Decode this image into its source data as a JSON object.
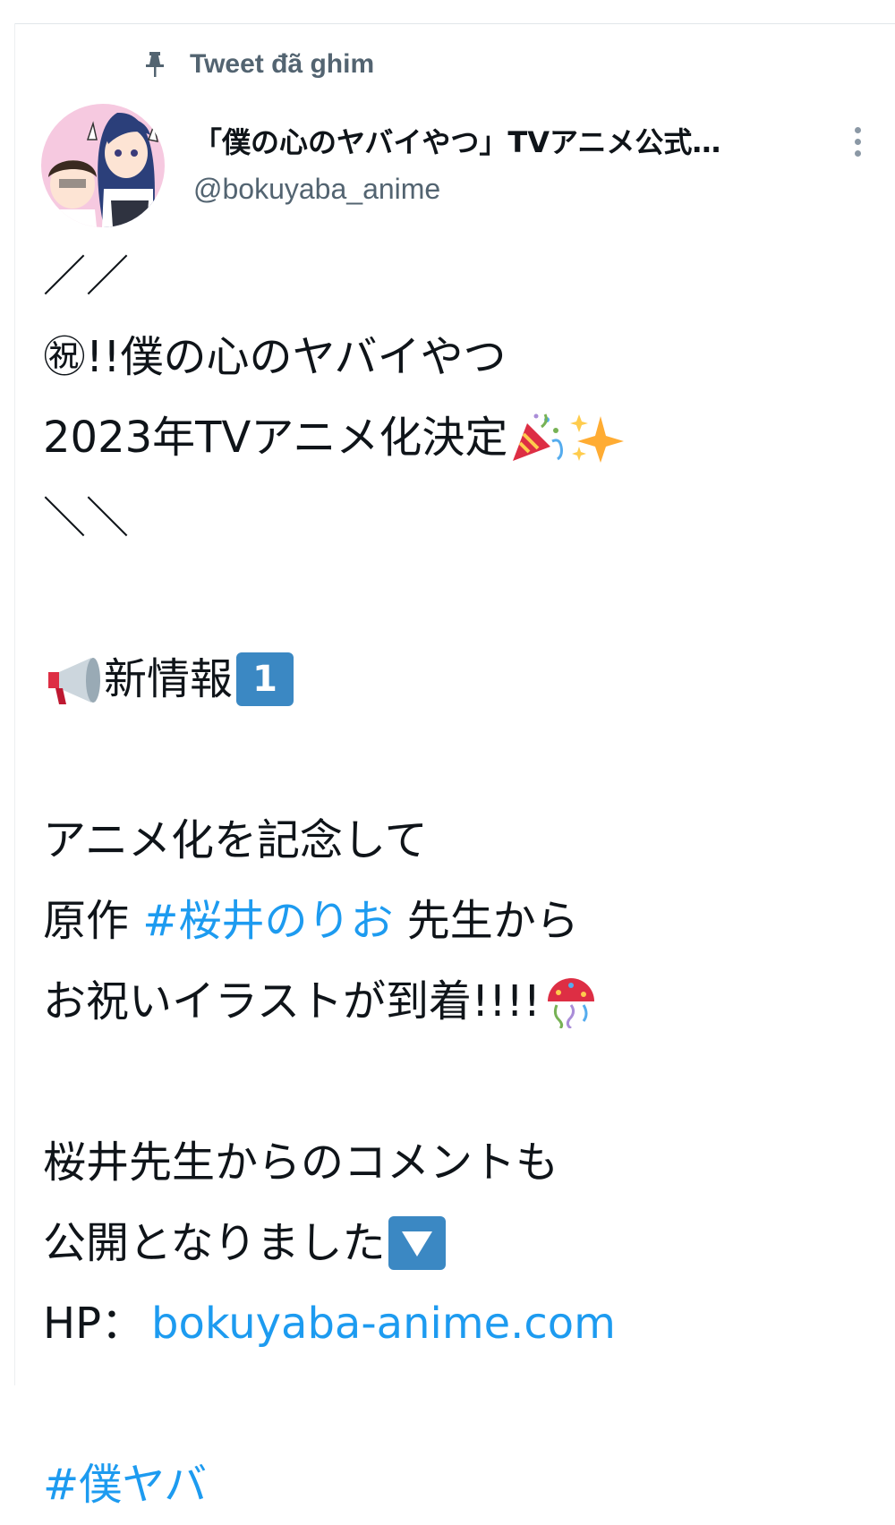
{
  "pinned": {
    "label": "Tweet đã ghim",
    "icon": "pin-icon"
  },
  "author": {
    "display_name": "「僕の心のヤバイやつ」TVアニメ公式…",
    "handle": "@bokuyaba_anime",
    "avatar": "avatar"
  },
  "menu": {
    "icon": "more-vertical-icon"
  },
  "tweet": {
    "slash_open": "／／",
    "line1": "㊗!!僕の心のヤバイやつ",
    "line2": "2023年TVアニメ化決定",
    "slash_close": "＼＼",
    "info_label": "新情報",
    "info_number": "1",
    "line3": "アニメ化を記念して",
    "line4_prefix": "原作 ",
    "line4_hashtag": "#桜井のりお",
    "line4_suffix": " 先生から",
    "line5": "お祝いイラストが到着!!!!",
    "line6": "桜井先生からのコメントも",
    "line7": "公開となりました",
    "hp_label": "HP：",
    "hp_link": "bokuyaba-anime.com",
    "hashtag_footer": "#僕ヤバ"
  },
  "colors": {
    "link": "#1d9bf0",
    "muted": "#536471",
    "text": "#0f1419"
  },
  "emoji_icons": [
    "party-popper-icon",
    "sparkles-icon",
    "megaphone-icon",
    "keycap-one-icon",
    "confetti-ball-icon",
    "down-arrow-button-icon"
  ]
}
